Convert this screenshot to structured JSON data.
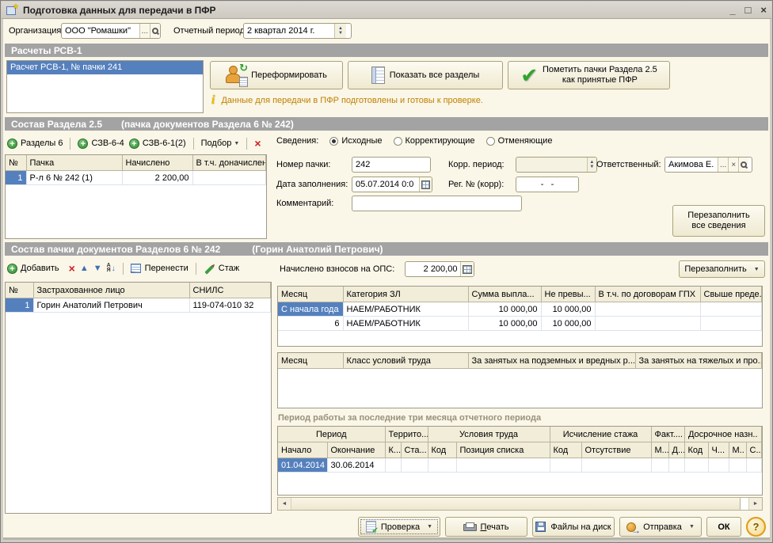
{
  "window": {
    "title": "Подготовка данных для передачи в ПФР",
    "minimize": "_",
    "maximize": "□",
    "close": "×"
  },
  "topbar": {
    "org_label": "Организация:",
    "org_value": "ООО \"Ромашки\"",
    "dots": "...",
    "period_label": "Отчетный период:",
    "period_value": "2 квартал 2014 г."
  },
  "rsv": {
    "title": "Расчеты РСВ-1",
    "item": "Расчет РСВ-1, № пачки 241",
    "reform": "Переформировать",
    "show_all": "Показать все разделы",
    "mark1": "Пометить пачки Раздела 2.5",
    "mark2": "как принятые ПФР",
    "info": "Данные для передачи в ПФР подготовлены и готовы к проверке."
  },
  "s25": {
    "title": "Состав Раздела 2.5",
    "subtitle": "(пачка документов Раздела 6 № 242)",
    "tb": {
      "sections6": "Разделы 6",
      "szv64": "СЗВ-6-4",
      "szv612": "СЗВ-6-1(2)",
      "podbor": "Подбор"
    },
    "cols": [
      "№",
      "Пачка",
      "Начислено",
      "В т.ч. доначислено"
    ],
    "row": [
      "1",
      "Р-л 6 № 242 (1)",
      "2 200,00",
      ""
    ],
    "form": {
      "sved": "Сведения:",
      "r1": "Исходные",
      "r2": "Корректирующие",
      "r3": "Отменяющие",
      "num_label": "Номер пачки:",
      "num_value": "242",
      "korr_label": "Корр. период:",
      "korr_value": "",
      "resp_label": "Ответственный:",
      "resp_value": "Акимова Е.",
      "date_label": "Дата заполнения:",
      "date_value": "05.07.2014 0:0",
      "reg_label": "Рег. № (корр):",
      "reg_value": "-   -",
      "comment_label": "Комментарий:",
      "comment_value": "",
      "refill1": "Перезаполнить",
      "refill2": "все сведения"
    }
  },
  "pack": {
    "title": "Состав пачки документов Разделов 6 № 242",
    "subtitle": "(Горин Анатолий Петрович)",
    "tb": {
      "add": "Добавить",
      "move": "Перенести",
      "staj": "Стаж",
      "ops_label": "Начислено взносов на ОПС:",
      "ops_value": "2 200,00",
      "refill": "Перезаполнить"
    },
    "persons": {
      "cols": [
        "№",
        "Застрахованное лицо",
        "СНИЛС"
      ],
      "row": [
        "1",
        "Горин Анатолий Петрович",
        "119-074-010 32"
      ]
    },
    "months": {
      "cols": [
        "Месяц",
        "Категория ЗЛ",
        "Сумма выпла...",
        "Не превы...",
        "В т.ч. по договорам ГПХ",
        "Свыше преде..."
      ],
      "rows": [
        [
          "С начала года",
          "НАЕМ/РАБОТНИК",
          "10 000,00",
          "10 000,00",
          "",
          ""
        ],
        [
          "6",
          "НАЕМ/РАБОТНИК",
          "10 000,00",
          "10 000,00",
          "",
          ""
        ]
      ]
    },
    "classes": {
      "cols": [
        "Месяц",
        "Класс условий труда",
        "За занятых на подземных и вредных р...",
        "За занятых на тяжелых и про..."
      ]
    },
    "period_title": "Период работы за последние три месяца отчетного периода",
    "periods": {
      "groups": [
        "Период",
        "Террито...",
        "Условия труда",
        "Исчисление стажа",
        "Факт....",
        "Досрочное назн.."
      ],
      "cols": [
        "Начало",
        "Окончание",
        "К...",
        "Ста...",
        "Код",
        "Позиция списка",
        "Код",
        "Отсутствие",
        "М...",
        "Д...",
        "Код",
        "Ч...",
        "М..",
        "С.."
      ],
      "row": [
        "01.04.2014",
        "30.06.2014",
        "",
        "",
        "",
        "",
        "",
        "",
        "",
        "",
        "",
        "",
        "",
        ""
      ]
    }
  },
  "footer": {
    "check": "Проверка",
    "print": "Печать",
    "files": "Файлы на диск",
    "send": "Отправка",
    "ok": "ОК",
    "help": "?"
  }
}
